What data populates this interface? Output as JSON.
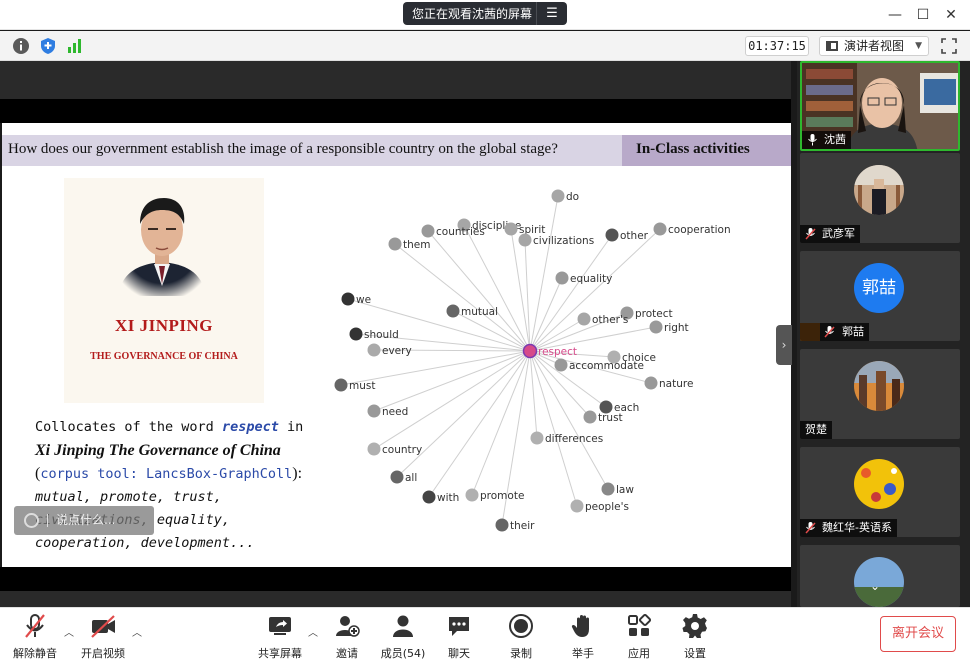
{
  "titlebar": {
    "share_status": "您正在观看沈茜的屏幕"
  },
  "toolbar": {
    "timer": "01:37:15",
    "view_mode": "演讲者视图"
  },
  "slide": {
    "question": "How does our government establish the image of a responsible country on the global stage?",
    "activity_label": "In-Class activities",
    "book": {
      "title": "XI JINPING",
      "subtitle": "THE GOVERNANCE OF CHINA"
    },
    "caption": {
      "line1_prefix": "Collocates of the word ",
      "keyword": "respect",
      "line1_suffix": " in",
      "book_title": "Xi Jinping The Governance of China",
      "tool_open": "(",
      "tool": "corpus tool: LancsBox-GraphColl",
      "tool_close": "):",
      "line4": "mutual, promote, trust,",
      "line5": "civilizations, equality,",
      "line6": "cooperation, development..."
    },
    "graph": {
      "center": "respect",
      "nodes": [
        "do",
        "discipline",
        "countries",
        "spirit",
        "civilizations",
        "them",
        "other",
        "cooperation",
        "equality",
        "we",
        "mutual",
        "protect",
        "other's",
        "right",
        "should",
        "every",
        "choice",
        "accommodate",
        "must",
        "nature",
        "each",
        "need",
        "trust",
        "differences",
        "country",
        "all",
        "law",
        "with",
        "promote",
        "people's",
        "their"
      ]
    }
  },
  "danmu": {
    "placeholder": "说点什么..."
  },
  "participants": [
    {
      "name": "沈茜",
      "muted": false,
      "active": true
    },
    {
      "name": "武彦军",
      "muted": true
    },
    {
      "name": "郭喆",
      "muted": true,
      "avatar_text": "郭喆",
      "avatar_color": "#1e7bf0"
    },
    {
      "name": "贺楚",
      "muted": false
    },
    {
      "name": "魏红华-英语系",
      "muted": true
    }
  ],
  "bottom": {
    "unmute": "解除静音",
    "start_video": "开启视频",
    "share_screen": "共享屏幕",
    "invite": "邀请",
    "members": "成员(54)",
    "chat": "聊天",
    "record": "录制",
    "raise_hand": "举手",
    "apps": "应用",
    "settings": "设置",
    "leave": "离开会议"
  },
  "colors": {
    "accent_green": "#2eb82e",
    "leave_red": "#e04b4b",
    "keyword_blue": "#2b4aa8",
    "book_red": "#b31b1b"
  }
}
